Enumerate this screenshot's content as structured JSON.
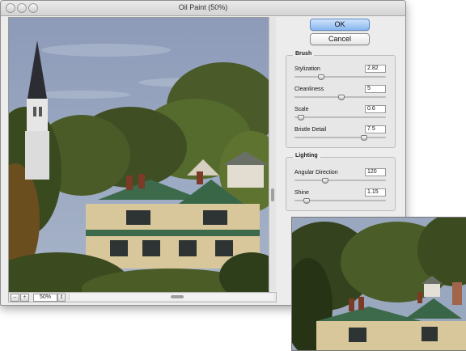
{
  "window": {
    "title": "Oil Paint (50%)"
  },
  "buttons": {
    "ok": "OK",
    "cancel": "Cancel"
  },
  "zoom": {
    "minus": "–",
    "plus": "+",
    "level": "50%",
    "dropdown": "⇕"
  },
  "brush": {
    "label": "Brush",
    "params": [
      {
        "label": "Stylization",
        "value": "2.82",
        "level": 0.28
      },
      {
        "label": "Cleanliness",
        "value": "5",
        "level": 0.5
      },
      {
        "label": "Scale",
        "value": "0.6",
        "level": 0.06
      },
      {
        "label": "Bristle Detail",
        "value": "7.5",
        "level": 0.75
      }
    ]
  },
  "lighting": {
    "label": "Lighting",
    "params": [
      {
        "label": "Angular Direction",
        "value": "120",
        "level": 0.33
      },
      {
        "label": "Shine",
        "value": "1.15",
        "level": 0.12
      }
    ]
  },
  "colors": {
    "sky": "#8393b3",
    "foliage_dark": "#3d4d22",
    "foliage_mid": "#6a7b34",
    "roof": "#3c6a4b",
    "house": "#d8c79a",
    "ok_accent": "#88b6ef"
  }
}
